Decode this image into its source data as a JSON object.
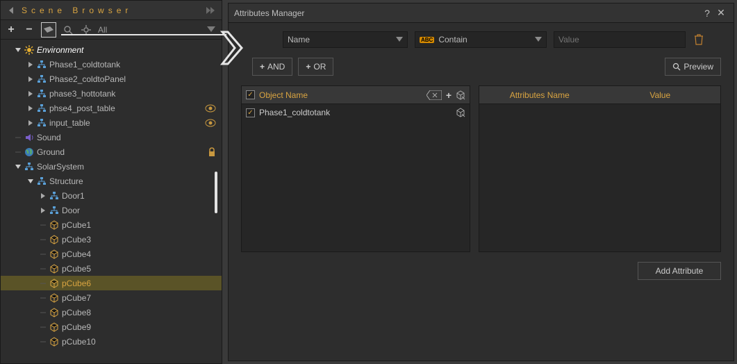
{
  "scene": {
    "title": "Scene Browser",
    "filter_all": "All",
    "tree": [
      {
        "d": 0,
        "exp": "down",
        "icon": "sun",
        "label": "Environment",
        "cls": "env-label"
      },
      {
        "d": 1,
        "exp": "right",
        "icon": "hier",
        "label": "Phase1_coldtotank"
      },
      {
        "d": 1,
        "exp": "right",
        "icon": "hier",
        "label": "Phase2_coldtoPanel"
      },
      {
        "d": 1,
        "exp": "right",
        "icon": "hier",
        "label": "phase3_hottotank"
      },
      {
        "d": 1,
        "exp": "right",
        "icon": "hier",
        "label": "phse4_post_table",
        "eye": true
      },
      {
        "d": 1,
        "exp": "right",
        "icon": "hier",
        "label": "input_table",
        "eye": true
      },
      {
        "d": 0,
        "exp": "leaf",
        "icon": "sound",
        "label": "Sound"
      },
      {
        "d": 0,
        "exp": "leaf",
        "icon": "globe",
        "label": "Ground",
        "lock": true
      },
      {
        "d": 0,
        "exp": "down",
        "icon": "hier",
        "label": "SolarSystem"
      },
      {
        "d": 1,
        "exp": "down",
        "icon": "hier",
        "label": "Structure"
      },
      {
        "d": 2,
        "exp": "right",
        "icon": "hier",
        "label": "Door1"
      },
      {
        "d": 2,
        "exp": "right",
        "icon": "hier",
        "label": "Door"
      },
      {
        "d": 2,
        "exp": "leaf",
        "icon": "cube",
        "label": "pCube1"
      },
      {
        "d": 2,
        "exp": "leaf",
        "icon": "cube",
        "label": "pCube3"
      },
      {
        "d": 2,
        "exp": "leaf",
        "icon": "cube",
        "label": "pCube4"
      },
      {
        "d": 2,
        "exp": "leaf",
        "icon": "cube",
        "label": "pCube5"
      },
      {
        "d": 2,
        "exp": "leaf",
        "icon": "cube",
        "label": "pCube6",
        "sel": true
      },
      {
        "d": 2,
        "exp": "leaf",
        "icon": "cube",
        "label": "pCube7"
      },
      {
        "d": 2,
        "exp": "leaf",
        "icon": "cube",
        "label": "pCube8"
      },
      {
        "d": 2,
        "exp": "leaf",
        "icon": "cube",
        "label": "pCube9"
      },
      {
        "d": 2,
        "exp": "leaf",
        "icon": "cube",
        "label": "pCube10"
      }
    ]
  },
  "attr": {
    "title": "Attributes Manager",
    "filter": {
      "name": "Name",
      "contain": "Contain",
      "value_placeholder": "Value"
    },
    "btn": {
      "and": "AND",
      "or": "OR",
      "preview": "Preview",
      "add": "Add Attribute"
    },
    "left": {
      "header": "Object Name",
      "rows": [
        "Phase1_coldtotank"
      ]
    },
    "right": {
      "col1": "Attributes Name",
      "col2": "Value"
    }
  }
}
